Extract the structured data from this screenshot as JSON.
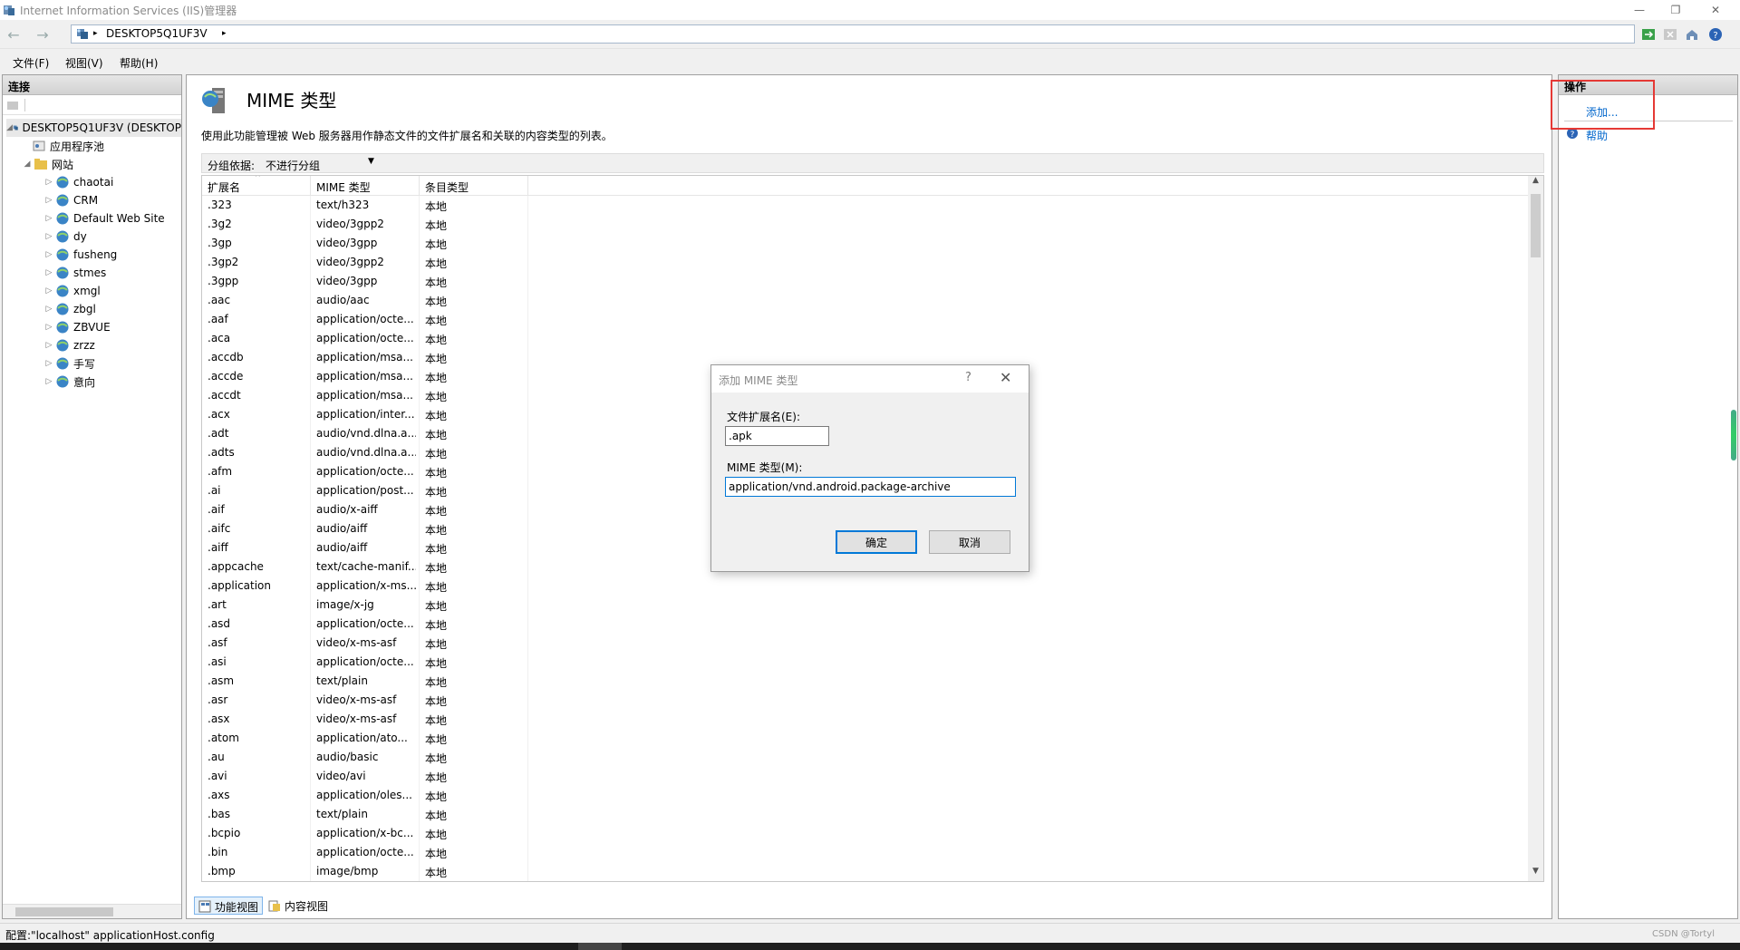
{
  "window": {
    "title": "Internet Information Services (IIS)管理器",
    "minimize": "—",
    "restore": "❐",
    "close": "✕"
  },
  "address": {
    "back": "←",
    "forward": "→",
    "server": "DESKTOP5Q1UF3V",
    "sep1": "▸",
    "sep2": "▸"
  },
  "menu": {
    "file": "文件(F)",
    "view": "视图(V)",
    "help": "帮助(H)"
  },
  "connections": {
    "header": "连接",
    "server_node": "DESKTOP5Q1UF3V (DESKTOP",
    "app_pools": "应用程序池",
    "sites_node": "网站",
    "sites": [
      "chaotai",
      "CRM",
      "Default Web Site",
      "dy",
      "fusheng",
      "stmes",
      "xmgl",
      "zbgl",
      "ZBVUE",
      "zrzz",
      "手写",
      "意向"
    ]
  },
  "feature": {
    "title": "MIME 类型",
    "description": "使用此功能管理被 Web 服务器用作静态文件的文件扩展名和关联的内容类型的列表。",
    "group_by_label": "分组依据:",
    "group_by_value": "不进行分组",
    "columns": [
      "扩展名",
      "MIME 类型",
      "条目类型"
    ],
    "rows": [
      [
        ".323",
        "text/h323",
        "本地"
      ],
      [
        ".3g2",
        "video/3gpp2",
        "本地"
      ],
      [
        ".3gp",
        "video/3gpp",
        "本地"
      ],
      [
        ".3gp2",
        "video/3gpp2",
        "本地"
      ],
      [
        ".3gpp",
        "video/3gpp",
        "本地"
      ],
      [
        ".aac",
        "audio/aac",
        "本地"
      ],
      [
        ".aaf",
        "application/octe...",
        "本地"
      ],
      [
        ".aca",
        "application/octe...",
        "本地"
      ],
      [
        ".accdb",
        "application/msa...",
        "本地"
      ],
      [
        ".accde",
        "application/msa...",
        "本地"
      ],
      [
        ".accdt",
        "application/msa...",
        "本地"
      ],
      [
        ".acx",
        "application/inter...",
        "本地"
      ],
      [
        ".adt",
        "audio/vnd.dlna.a...",
        "本地"
      ],
      [
        ".adts",
        "audio/vnd.dlna.a...",
        "本地"
      ],
      [
        ".afm",
        "application/octe...",
        "本地"
      ],
      [
        ".ai",
        "application/post...",
        "本地"
      ],
      [
        ".aif",
        "audio/x-aiff",
        "本地"
      ],
      [
        ".aifc",
        "audio/aiff",
        "本地"
      ],
      [
        ".aiff",
        "audio/aiff",
        "本地"
      ],
      [
        ".appcache",
        "text/cache-manif...",
        "本地"
      ],
      [
        ".application",
        "application/x-ms...",
        "本地"
      ],
      [
        ".art",
        "image/x-jg",
        "本地"
      ],
      [
        ".asd",
        "application/octe...",
        "本地"
      ],
      [
        ".asf",
        "video/x-ms-asf",
        "本地"
      ],
      [
        ".asi",
        "application/octe...",
        "本地"
      ],
      [
        ".asm",
        "text/plain",
        "本地"
      ],
      [
        ".asr",
        "video/x-ms-asf",
        "本地"
      ],
      [
        ".asx",
        "video/x-ms-asf",
        "本地"
      ],
      [
        ".atom",
        "application/ato...",
        "本地"
      ],
      [
        ".au",
        "audio/basic",
        "本地"
      ],
      [
        ".avi",
        "video/avi",
        "本地"
      ],
      [
        ".axs",
        "application/oles...",
        "本地"
      ],
      [
        ".bas",
        "text/plain",
        "本地"
      ],
      [
        ".bcpio",
        "application/x-bc...",
        "本地"
      ],
      [
        ".bin",
        "application/octe...",
        "本地"
      ],
      [
        ".bmp",
        "image/bmp",
        "本地"
      ]
    ],
    "view_tabs": [
      "功能视图",
      "内容视图"
    ]
  },
  "actions": {
    "header": "操作",
    "add": "添加...",
    "help": "帮助"
  },
  "dialog": {
    "title": "添加 MIME 类型",
    "help_glyph": "?",
    "close_glyph": "✕",
    "ext_label": "文件扩展名(E):",
    "ext_value": ".apk",
    "mime_label": "MIME 类型(M):",
    "mime_value": "application/vnd.android.package-archive",
    "ok": "确定",
    "cancel": "取消"
  },
  "status": {
    "text": "配置:\"localhost\" applicationHost.config",
    "watermark": "CSDN @Tortyl"
  },
  "colors": {
    "link": "#0066cc",
    "highlight": "#e53935",
    "focus": "#0078d7"
  }
}
